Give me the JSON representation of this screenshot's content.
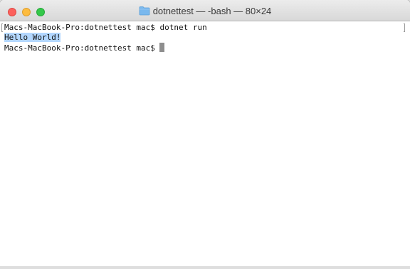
{
  "window": {
    "title": "dotnettest — -bash — 80×24"
  },
  "terminal": {
    "lines": [
      "Macs-MacBook-Pro:dotnettest mac$ dotnet run",
      "Hello World!",
      "Macs-MacBook-Pro:dotnettest mac$"
    ]
  },
  "colors": {
    "selection": "#b3d7ff",
    "cursor": "#8e8e8e",
    "close": "#fc605c",
    "minimize": "#fdbc40",
    "zoom": "#34c84a"
  },
  "icons": {
    "title_icon": "folder-icon"
  }
}
